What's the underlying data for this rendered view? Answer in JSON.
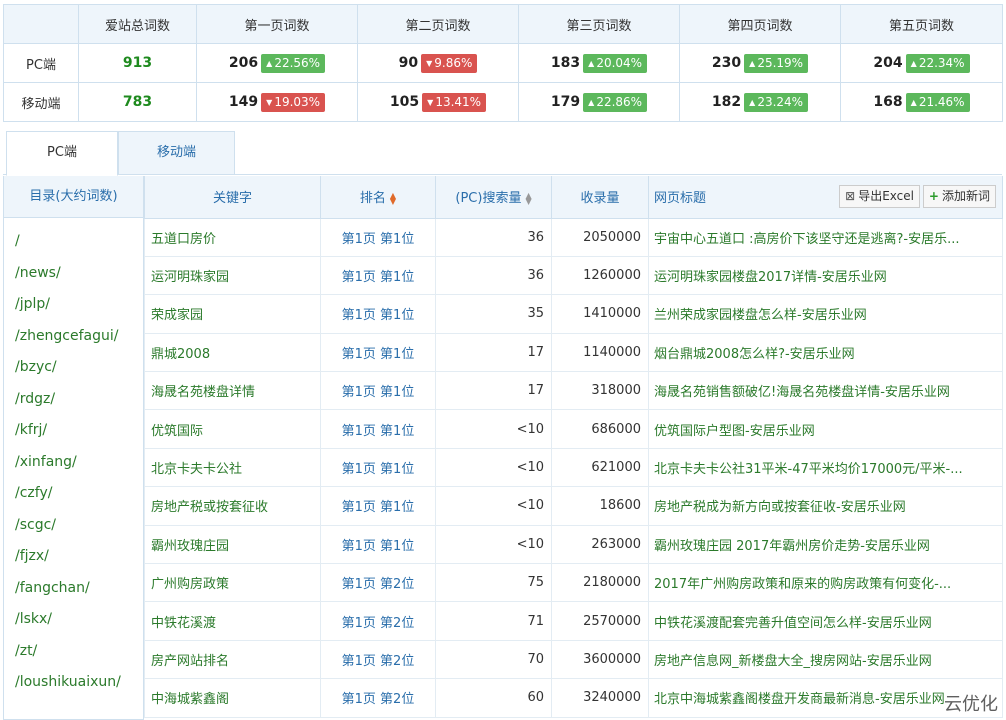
{
  "summary": {
    "headers": [
      "",
      "爱站总词数",
      "第一页词数",
      "第二页词数",
      "第三页词数",
      "第四页词数",
      "第五页词数"
    ],
    "rows": [
      {
        "label": "PC端",
        "total": "913",
        "pages": [
          {
            "value": "206",
            "change": "22.56%",
            "dir": "up"
          },
          {
            "value": "90",
            "change": "9.86%",
            "dir": "down"
          },
          {
            "value": "183",
            "change": "20.04%",
            "dir": "up"
          },
          {
            "value": "230",
            "change": "25.19%",
            "dir": "up"
          },
          {
            "value": "204",
            "change": "22.34%",
            "dir": "up"
          }
        ]
      },
      {
        "label": "移动端",
        "total": "783",
        "pages": [
          {
            "value": "149",
            "change": "19.03%",
            "dir": "down"
          },
          {
            "value": "105",
            "change": "13.41%",
            "dir": "down"
          },
          {
            "value": "179",
            "change": "22.86%",
            "dir": "up"
          },
          {
            "value": "182",
            "change": "23.24%",
            "dir": "up"
          },
          {
            "value": "168",
            "change": "21.46%",
            "dir": "up"
          }
        ]
      }
    ]
  },
  "tabs": [
    {
      "label": "PC端",
      "active": true
    },
    {
      "label": "移动端",
      "active": false
    }
  ],
  "directory": {
    "header": "目录(大约词数)",
    "items": [
      "/",
      "/news/",
      "/jplp/",
      "/zhengcefagui/",
      "/bzyc/",
      "/rdgz/",
      "/kfrj/",
      "/xinfang/",
      "/czfy/",
      "/scgc/",
      "/fjzx/",
      "/fangchan/",
      "/lskx/",
      "/zt/",
      "/loushikuaixun/"
    ]
  },
  "table": {
    "headers": {
      "keyword": "关键字",
      "rank": "排名",
      "volume": "(PC)搜索量",
      "indexed": "收录量",
      "title": "网页标题"
    },
    "export_label": "导出Excel",
    "add_label": "添加新词",
    "rows": [
      {
        "keyword": "五道口房价",
        "rank": "第1页 第1位",
        "volume": "36",
        "indexed": "2050000",
        "title": "宇宙中心五道口 :高房价下该坚守还是逃离?-安居乐..."
      },
      {
        "keyword": "运河明珠家园",
        "rank": "第1页 第1位",
        "volume": "36",
        "indexed": "1260000",
        "title": "运河明珠家园楼盘2017详情-安居乐业网"
      },
      {
        "keyword": "荣成家园",
        "rank": "第1页 第1位",
        "volume": "35",
        "indexed": "1410000",
        "title": "兰州荣成家园楼盘怎么样-安居乐业网"
      },
      {
        "keyword": "鼎城2008",
        "rank": "第1页 第1位",
        "volume": "17",
        "indexed": "1140000",
        "title": "烟台鼎城2008怎么样?-安居乐业网"
      },
      {
        "keyword": "海晟名苑楼盘详情",
        "rank": "第1页 第1位",
        "volume": "17",
        "indexed": "318000",
        "title": "海晟名苑销售额破亿!海晟名苑楼盘详情-安居乐业网"
      },
      {
        "keyword": "优筑国际",
        "rank": "第1页 第1位",
        "volume": "<10",
        "indexed": "686000",
        "title": "优筑国际户型图-安居乐业网"
      },
      {
        "keyword": "北京卡夫卡公社",
        "rank": "第1页 第1位",
        "volume": "<10",
        "indexed": "621000",
        "title": "北京卡夫卡公社31平米-47平米均价17000元/平米-..."
      },
      {
        "keyword": "房地产税或按套征收",
        "rank": "第1页 第1位",
        "volume": "<10",
        "indexed": "18600",
        "title": "房地产税成为新方向或按套征收-安居乐业网"
      },
      {
        "keyword": "霸州玫瑰庄园",
        "rank": "第1页 第1位",
        "volume": "<10",
        "indexed": "263000",
        "title": "霸州玫瑰庄园 2017年霸州房价走势-安居乐业网"
      },
      {
        "keyword": "广州购房政策",
        "rank": "第1页 第2位",
        "volume": "75",
        "indexed": "2180000",
        "title": "2017年广州购房政策和原来的购房政策有何变化-..."
      },
      {
        "keyword": "中铁花溪渡",
        "rank": "第1页 第2位",
        "volume": "71",
        "indexed": "2570000",
        "title": "中铁花溪渡配套完善升值空间怎么样-安居乐业网"
      },
      {
        "keyword": "房产网站排名",
        "rank": "第1页 第2位",
        "volume": "70",
        "indexed": "3600000",
        "title": "房地产信息网_新楼盘大全_搜房网站-安居乐业网"
      },
      {
        "keyword": "中海城紫鑫阁",
        "rank": "第1页 第2位",
        "volume": "60",
        "indexed": "3240000",
        "title": "北京中海城紫鑫阁楼盘开发商最新消息-安居乐业网"
      }
    ]
  },
  "watermark": "云优化"
}
